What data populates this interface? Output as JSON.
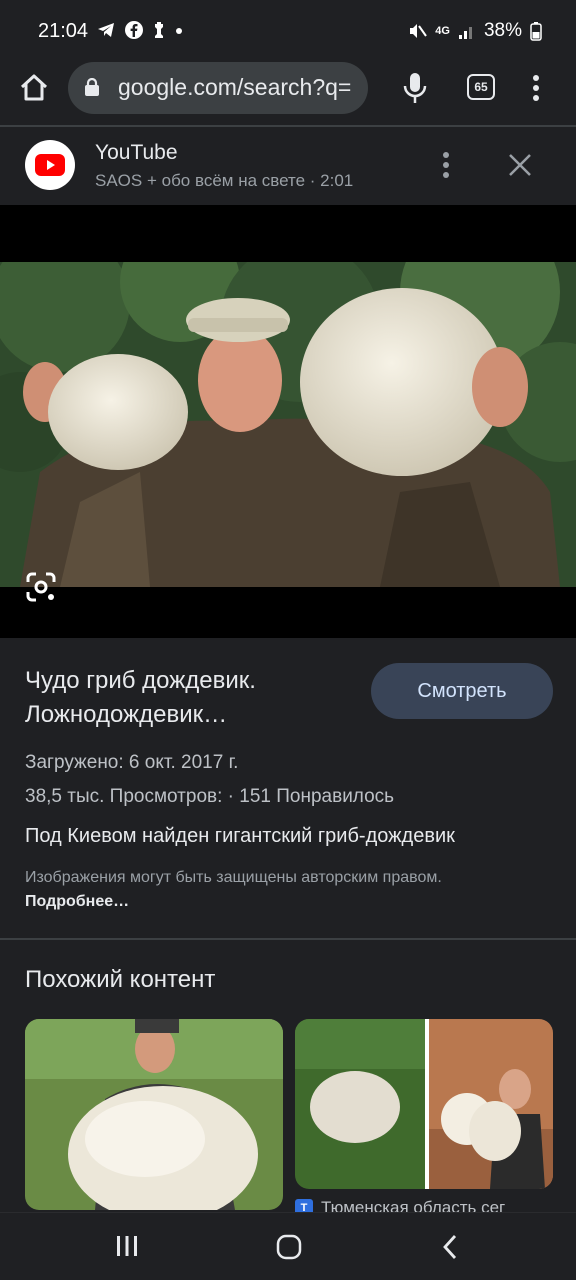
{
  "status_bar": {
    "time": "21:04",
    "left_icons": [
      "telegram-icon",
      "facebook-icon",
      "chess-icon",
      "dot-icon"
    ],
    "battery": "38%",
    "network": "4G"
  },
  "browser": {
    "url": "google.com/search?q=",
    "tab_count": "65"
  },
  "source": {
    "name": "YouTube",
    "subtitle": "SAOS + обо всём на свете · 2:01"
  },
  "result": {
    "title": "Чудо гриб дождевик. Ложнодождевик…",
    "watch_label": "Смотреть",
    "uploaded": "Загружено: 6 окт. 2017 г.",
    "stats": "38,5 тыс. Просмотров:  ·  151 Понравилось",
    "description": "Под Киевом найден гигантский гриб-дождевик",
    "copyright_text": "Изображения могут быть защищены авторским правом.",
    "copyright_link": "Подробнее…"
  },
  "related": {
    "heading": "Похожий контент",
    "card2_source": "Тюменская область сег"
  }
}
